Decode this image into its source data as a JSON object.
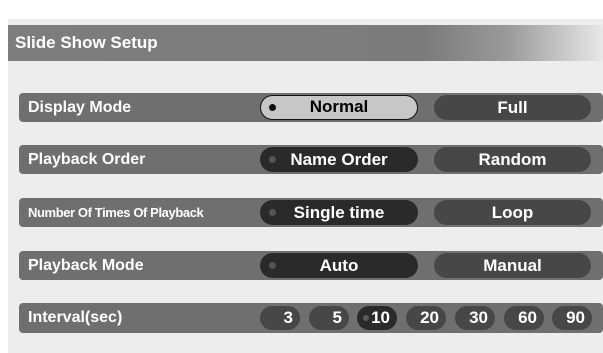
{
  "title": "Slide Show Setup",
  "rows": [
    {
      "label": "Display Mode",
      "options": [
        "Normal",
        "Full"
      ],
      "selected": "Normal"
    },
    {
      "label": "Playback Order",
      "options": [
        "Name Order",
        "Random"
      ],
      "selected": "Name Order"
    },
    {
      "label": "Number Of Times Of Playback",
      "options": [
        "Single time",
        "Loop"
      ],
      "selected": "Single time"
    },
    {
      "label": "Playback Mode",
      "options": [
        "Auto",
        "Manual"
      ],
      "selected": "Auto"
    },
    {
      "label": "Interval(sec)",
      "options": [
        "3",
        "5",
        "10",
        "20",
        "30",
        "60",
        "90"
      ],
      "selected": "10"
    }
  ],
  "colors": {
    "row_background": "#6f6f6f",
    "button_idle": "#474747",
    "button_selected": "#2a2a2a",
    "button_focused": "#c7c7c7"
  }
}
